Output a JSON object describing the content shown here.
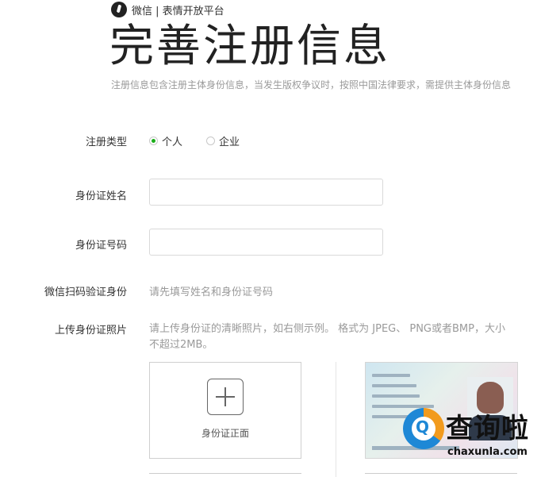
{
  "brand": {
    "text": "微信 | 表情开放平台"
  },
  "page": {
    "title": "完善注册信息",
    "description": "注册信息包含注册主体身份信息，当发生版权争议时，按照中国法律要求，需提供主体身份信息"
  },
  "form": {
    "register_type": {
      "label": "注册类型",
      "options": [
        {
          "label": "个人",
          "checked": true
        },
        {
          "label": "企业",
          "checked": false
        }
      ]
    },
    "id_name": {
      "label": "身份证姓名",
      "value": ""
    },
    "id_number": {
      "label": "身份证号码",
      "value": ""
    },
    "wechat_verify": {
      "label": "微信扫码验证身份",
      "hint": "请先填写姓名和身份证号码"
    },
    "upload": {
      "label": "上传身份证照片",
      "hint": "请上传身份证的清晰照片，如右侧示例。 格式为 JPEG、 PNG或者BMP，大小不超过2MB。",
      "front_label": "身份证正面"
    }
  },
  "watermark": {
    "title": "查询啦",
    "url": "chaxunla.com",
    "logo_letter": "Q"
  },
  "colors": {
    "accent": "#1aad19",
    "text": "#333333",
    "muted": "#9a9a9a"
  }
}
